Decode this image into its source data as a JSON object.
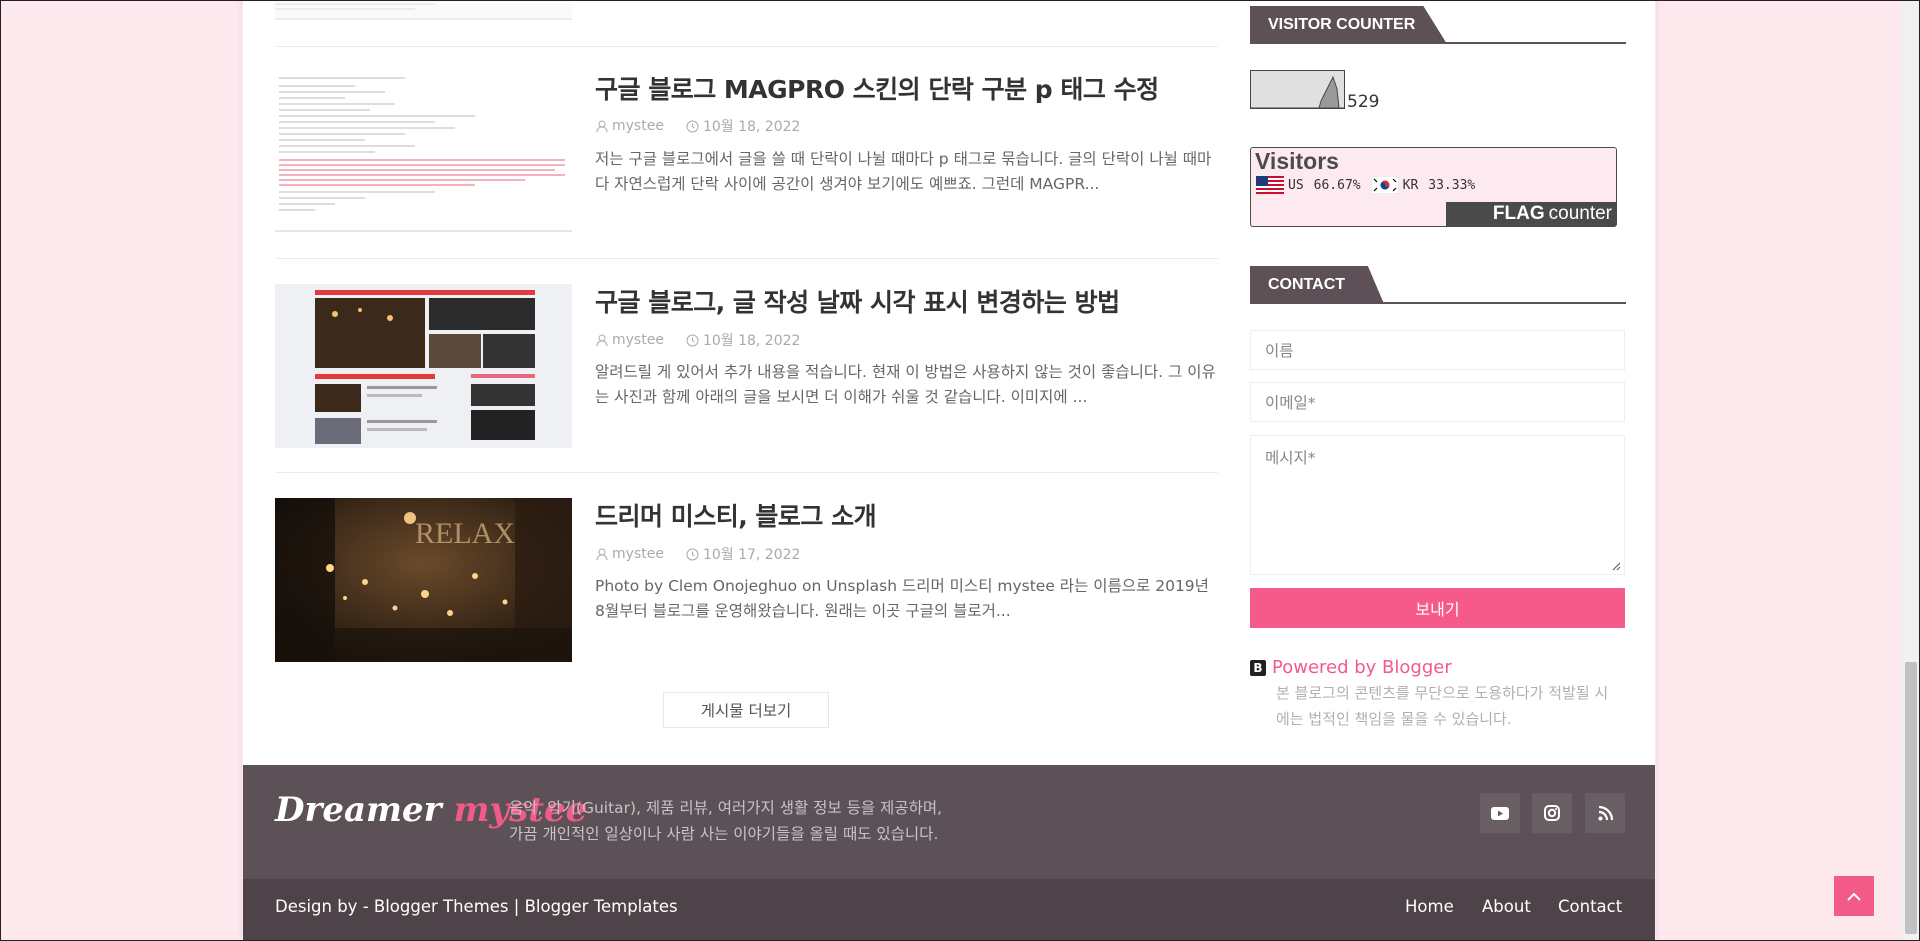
{
  "posts": [
    {
      "title": "구글 블로그 MAGPRO 스킨의 단락 구분 p 태그 수정",
      "author": "mystee",
      "date": "10월 18, 2022",
      "excerpt": "저는 구글 블로그에서 글을 쓸 때 단락이 나뉠 때마다 p 태그로 묶습니다. 글의 단락이 나뉠 때마다 자연스럽게 단락 사이에 공간이 생겨야 보기에도 예쁘죠. 그런데 MAGPR..."
    },
    {
      "title": "구글 블로그, 글 작성 날짜 시각 표시 변경하는 방법",
      "author": "mystee",
      "date": "10월 18, 2022",
      "excerpt": "알려드릴 게 있어서 추가 내용을 적습니다. 현재 이 방법은 사용하지 않는 것이 좋습니다. 그 이유는 사진과 함께 아래의 글을 보시면 더 이해가 쉬울 것 같습니다. 이미지에 ..."
    },
    {
      "title": "드리머 미스티, 블로그 소개",
      "author": "mystee",
      "date": "10월 17, 2022",
      "excerpt": "Photo by Clem Onojeghuo on Unsplash 드리머 미스티 mystee 라는 이름으로 2019년 8월부터 블로그를 운영해왔습니다. 원래는 이곳 구글의 블로거..."
    }
  ],
  "load_more": "게시물 더보기",
  "visitor_counter": {
    "title": "VISITOR COUNTER",
    "count": "529"
  },
  "flag_counter": {
    "title": "Visitors",
    "us_code": "US",
    "us_pct": "66.67%",
    "kr_code": "KR",
    "kr_pct": "33.33%",
    "badge_a": "FLAG",
    "badge_b": "counter"
  },
  "contact": {
    "title": "CONTACT",
    "name_placeholder": "이름",
    "email_placeholder": "이메일*",
    "message_placeholder": "메시지*",
    "send": "보내기"
  },
  "powered": {
    "label": "Powered by Blogger",
    "note": "본 블로그의 콘텐츠를 무단으로 도용하다가 적발될 시에는 법적인 책임을 물을 수 있습니다."
  },
  "footer": {
    "logo_white": "Dreamer",
    "logo_pink": "mystee",
    "desc_line1": "음악, 악기(Guitar), 제품 리뷰, 여러가지 생활 정보 등을 제공하며,",
    "desc_line2": "가끔 개인적인 일상이나 사람 사는 이야기들을 올릴 때도 있습니다.",
    "credit": "Design by - Blogger Themes | Blogger Templates",
    "nav": [
      "Home",
      "About",
      "Contact"
    ]
  },
  "colors": {
    "accent": "#f65a8b",
    "footer": "#5c5157",
    "footer_bottom": "#4d4349",
    "widget_tab": "#5e5057"
  }
}
